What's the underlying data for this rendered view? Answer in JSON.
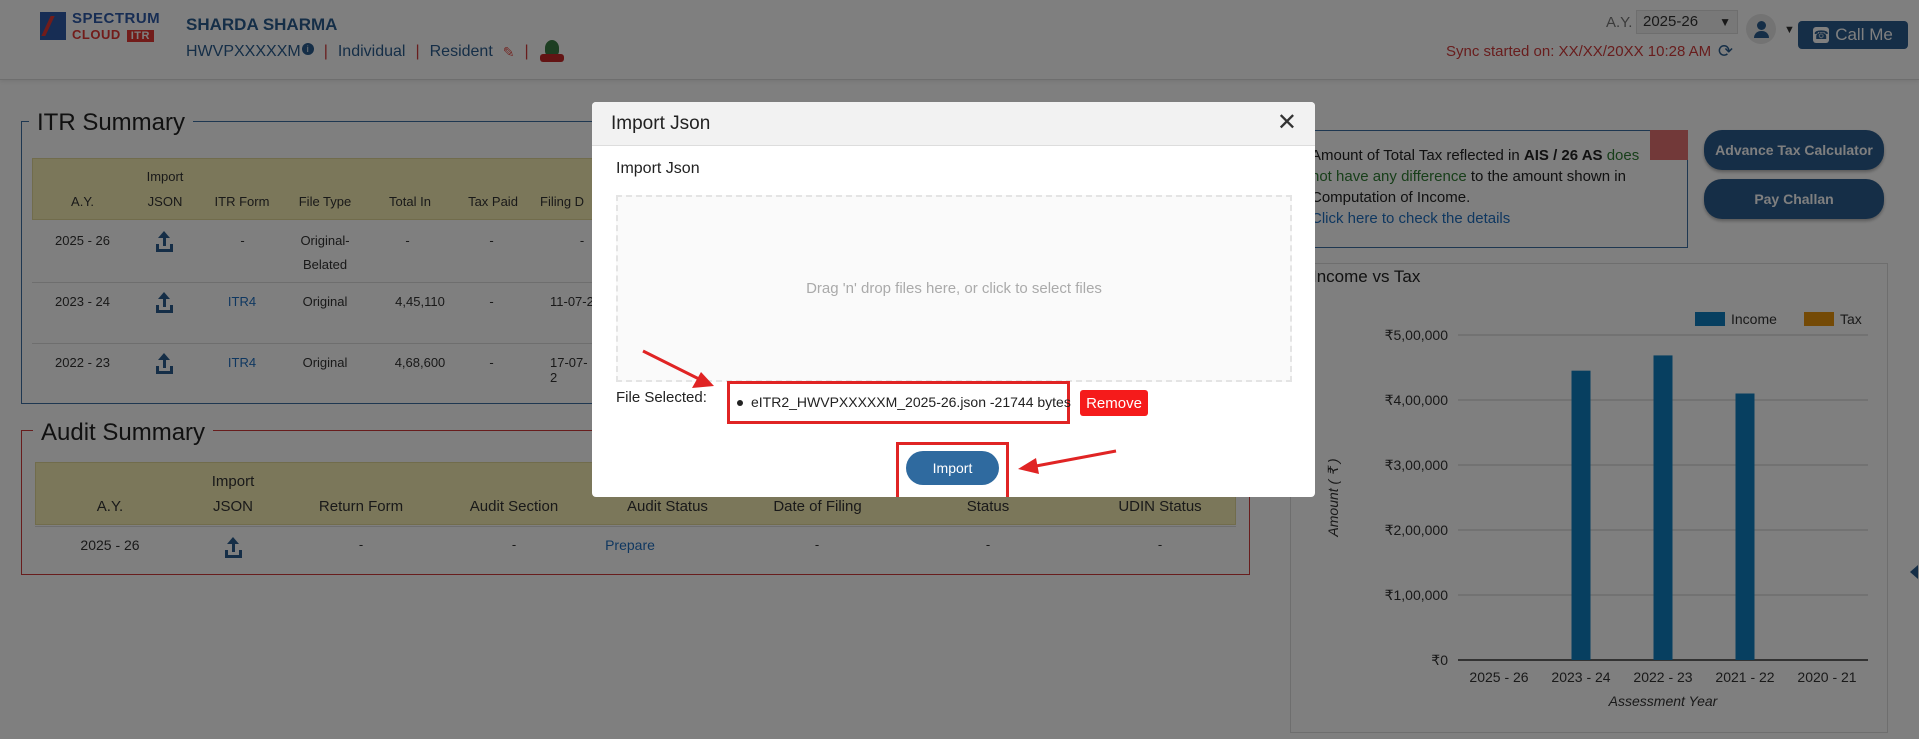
{
  "header": {
    "logo_top": "SPECTRUM",
    "logo_bottom": "CLOUD",
    "logo_itr": "ITR",
    "user_name": "SHARDA SHARMA",
    "pan": "HWVPXXXXXM",
    "info_glyph": "i",
    "status": "Individual",
    "residency": "Resident",
    "separator": "|",
    "ay_label": "A.Y.",
    "ay_value": "2025-26",
    "sync_text": "Sync started on: XX/XX/20XX 10:28 AM",
    "call_label": "Call Me"
  },
  "itr_summary": {
    "title": "ITR Summary",
    "columns": [
      "A.Y.",
      "Import JSON",
      "ITR Form",
      "File Type",
      "Total In",
      "Tax Paid",
      "Filing D"
    ],
    "import_top": "Import",
    "import_bottom": "JSON",
    "rows": [
      {
        "ay": "2025 - 26",
        "form": "-",
        "type_line1": "Original-",
        "type_line2": "Belated",
        "total": "-",
        "tax": "-",
        "filing": "-"
      },
      {
        "ay": "2023 - 24",
        "form": "ITR4",
        "type_line1": "Original",
        "type_line2": "",
        "total": "4,45,110",
        "tax": "-",
        "filing": "11-07-2"
      },
      {
        "ay": "2022 - 23",
        "form": "ITR4",
        "type_line1": "Original",
        "type_line2": "",
        "total": "4,68,600",
        "tax": "-",
        "filing": "17-07-2"
      }
    ]
  },
  "audit_summary": {
    "title": "Audit Summary",
    "columns": [
      "A.Y.",
      "Import JSON",
      "Return Form",
      "Audit Section",
      "Audit Status",
      "Date of Filing",
      "Status",
      "UDIN Status"
    ],
    "import_top": "Import",
    "import_bottom": "JSON",
    "row": {
      "ay": "2025 - 26",
      "form": "-",
      "section": "-",
      "audit_status": "Prepare",
      "date": "-",
      "status": "-",
      "udin": "-"
    }
  },
  "ais_notice": {
    "t1": "Amount of Total Tax reflected in ",
    "t2": "AIS / 26 AS",
    "t3": " does",
    "t4": "not have any difference",
    "t5": " to the amount shown in",
    "t6": "Computation of Income.",
    "link": "Click here to check the details"
  },
  "side_buttons": {
    "advance_tax": "Advance Tax Calculator",
    "pay_challan": "Pay Challan"
  },
  "chart_data": {
    "type": "bar",
    "title": "Income vs Tax",
    "xlabel": "Assessment Year",
    "ylabel": "Amount ( ₹ )",
    "categories": [
      "2025 - 26",
      "2023 - 24",
      "2022 - 23",
      "2021 - 22",
      "2020 - 21"
    ],
    "series": [
      {
        "name": "Income",
        "color": "#0e7fc0",
        "values": [
          0,
          445110,
          468600,
          410000,
          0
        ]
      },
      {
        "name": "Tax",
        "color": "#e8940c",
        "values": [
          0,
          0,
          0,
          0,
          0
        ]
      }
    ],
    "ylim": [
      0,
      500000
    ],
    "yticks": [
      0,
      100000,
      200000,
      300000,
      400000,
      500000
    ],
    "ytick_labels": [
      "₹0",
      "₹1,00,000",
      "₹2,00,000",
      "₹3,00,000",
      "₹4,00,000",
      "₹5,00,000"
    ],
    "legend": "top-right",
    "grid": true
  },
  "modal": {
    "title": "Import Json",
    "close_glyph": "✕",
    "subtitle": "Import Json",
    "dropzone_text": "Drag 'n' drop files here, or click to select files",
    "file_label": "File Selected:",
    "file_name": "eITR2_HWVPXXXXXM_2025-26.json -21744 bytes",
    "remove_label": "Remove",
    "import_label": "Import"
  },
  "colors": {
    "primary": "#2a5d8f",
    "highlight_red": "#e02424",
    "table_header": "#f6eeb4"
  }
}
